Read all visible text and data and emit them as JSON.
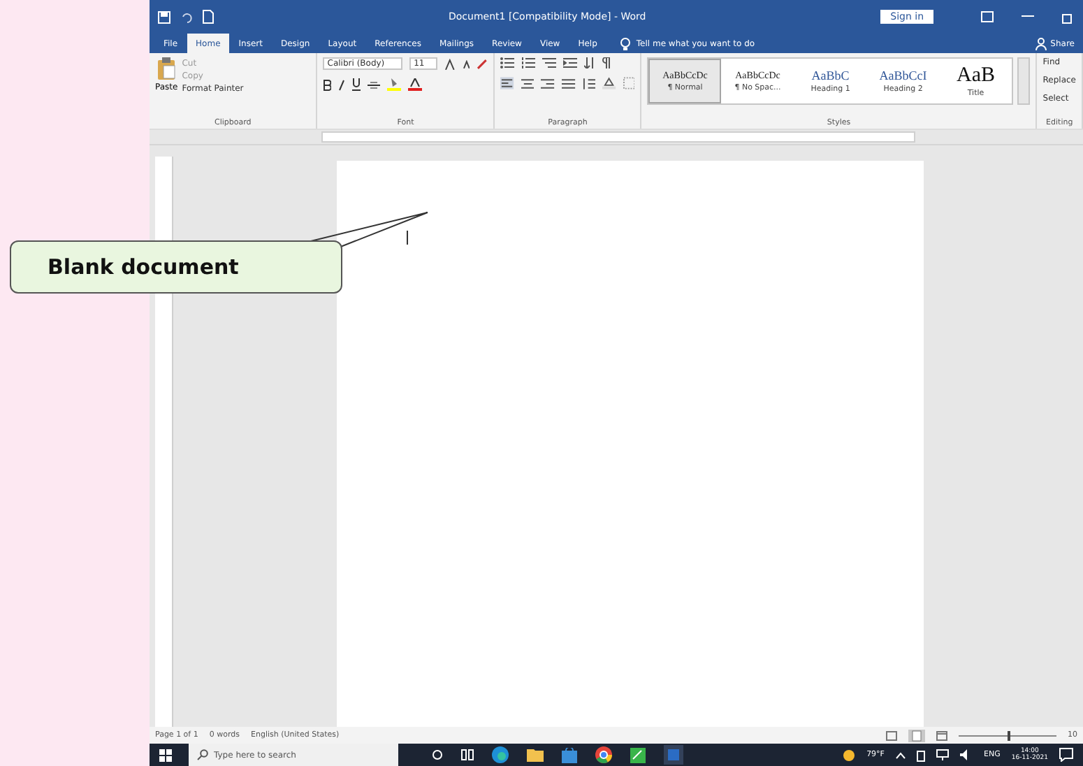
{
  "window": {
    "title": "Document1 [Compatibility Mode] - Word",
    "sign_in": "Sign in"
  },
  "tabs": [
    {
      "label": "File",
      "selected": false
    },
    {
      "label": "Home",
      "selected": true
    },
    {
      "label": "Insert",
      "selected": false
    },
    {
      "label": "Design",
      "selected": false
    },
    {
      "label": "Layout",
      "selected": false
    },
    {
      "label": "References",
      "selected": false
    },
    {
      "label": "Mailings",
      "selected": false
    },
    {
      "label": "Review",
      "selected": false
    },
    {
      "label": "View",
      "selected": false
    },
    {
      "label": "Help",
      "selected": false
    }
  ],
  "tell_me": "Tell me what you want to do",
  "share": "Share",
  "clipboard": {
    "paste": "Paste",
    "cut": "Cut",
    "copy": "Copy",
    "format_painter": "Format Painter",
    "label": "Clipboard"
  },
  "font": {
    "name": "Calibri (Body)",
    "size": "11",
    "label": "Font"
  },
  "paragraph": {
    "label": "Paragraph"
  },
  "styles": {
    "label": "Styles",
    "items": [
      {
        "sample": "AaBbCcDc",
        "name": "¶ Normal",
        "selected": true,
        "kind": "body"
      },
      {
        "sample": "AaBbCcDc",
        "name": "¶ No Spac...",
        "selected": false,
        "kind": "body"
      },
      {
        "sample": "AaBbC",
        "name": "Heading 1",
        "selected": false,
        "kind": "heading"
      },
      {
        "sample": "AaBbCcI",
        "name": "Heading 2",
        "selected": false,
        "kind": "heading"
      },
      {
        "sample": "AaB",
        "name": "Title",
        "selected": false,
        "kind": "title"
      }
    ]
  },
  "editing": {
    "label": "Editing",
    "items": [
      "Find",
      "Replace",
      "Select"
    ]
  },
  "status_bar": {
    "page": "Page 1 of 1",
    "words": "0 words",
    "language": "English (United States)",
    "zoom": "10",
    "zoom_slider": {
      "level": 0.5
    }
  },
  "taskbar": {
    "search_placeholder": "Type here to search",
    "weather": "79°F",
    "language": "ENG",
    "time": "14:00",
    "date": "16-11-2021"
  },
  "callout": {
    "text": "Blank document"
  }
}
